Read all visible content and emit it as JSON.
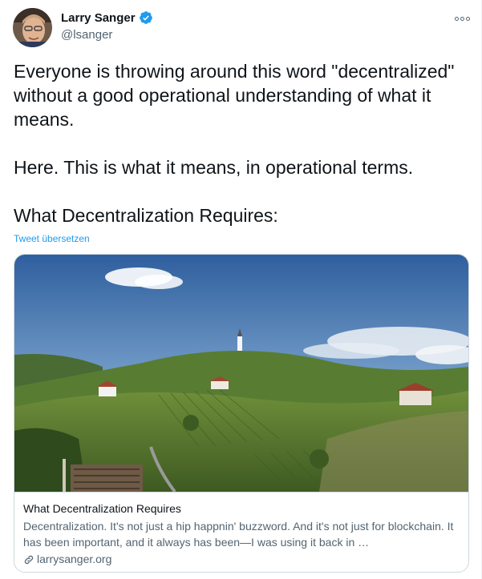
{
  "author": {
    "display_name": "Larry Sanger",
    "handle": "@lsanger",
    "verified": true,
    "avatar_icon": "profile-photo"
  },
  "tweet": {
    "paragraphs": [
      "Everyone is throwing around this word \"decentralized\" without a good operational understanding of what it means.",
      "Here. This is what it means, in operational terms.",
      "What Decentralization Requires:"
    ],
    "translate_label": "Tweet übersetzen"
  },
  "card": {
    "title": "What Decentralization Requires",
    "description": "Decentralization. It's not just a hip happnin' buzzword. And it's not just for blockchain. It has been important, and it always has been—I was using it back in …",
    "domain": "larrysanger.org",
    "image_subject": "landscape-photo"
  },
  "colors": {
    "link": "#1d9bf0",
    "secondary_text": "#536471",
    "verified_badge": "#1d9bf0"
  },
  "icons": {
    "more": "more-icon",
    "verified": "verified-badge-icon",
    "link": "link-icon"
  }
}
